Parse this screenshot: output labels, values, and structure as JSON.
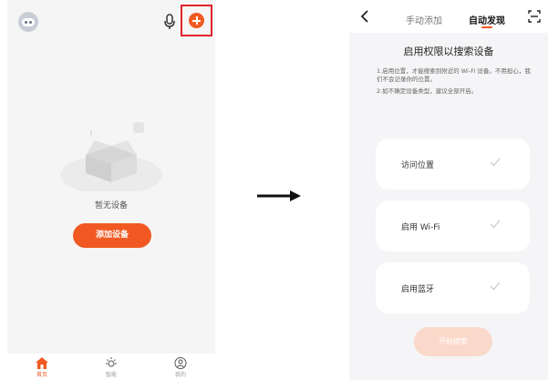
{
  "left_screen": {
    "empty_state": {
      "text": "暂无设备"
    },
    "add_device_button": {
      "label": "添加设备"
    },
    "tabbar": {
      "items": [
        {
          "label": "首页"
        },
        {
          "label": "智能"
        },
        {
          "label": "我的"
        }
      ]
    }
  },
  "right_screen": {
    "tabs": {
      "manual": "手动添加",
      "auto": "自动发现"
    },
    "permission": {
      "title": "启用权限以搜索设备",
      "desc_1": "1.启用位置，才能搜索到附近的 Wi-Fi 设备。不用担心，我们不会记录你的位置。",
      "desc_2": "2.如不确定设备类型，建议全部开启。"
    },
    "cards": [
      {
        "label": "访问位置"
      },
      {
        "label": "启用 Wi-Fi"
      },
      {
        "label": "启用蓝牙"
      }
    ],
    "start_button": {
      "label": "开始搜索"
    }
  },
  "colors": {
    "accent": "#f05a22",
    "highlight_box": "#e3242b",
    "start_disabled": "#fbd9ca"
  },
  "icons": [
    "avatar-icon",
    "mic-icon",
    "add-icon",
    "box-icon",
    "home-icon",
    "sun-icon",
    "user-icon",
    "arrow-right-icon",
    "back-icon",
    "scan-icon",
    "check-icon"
  ]
}
